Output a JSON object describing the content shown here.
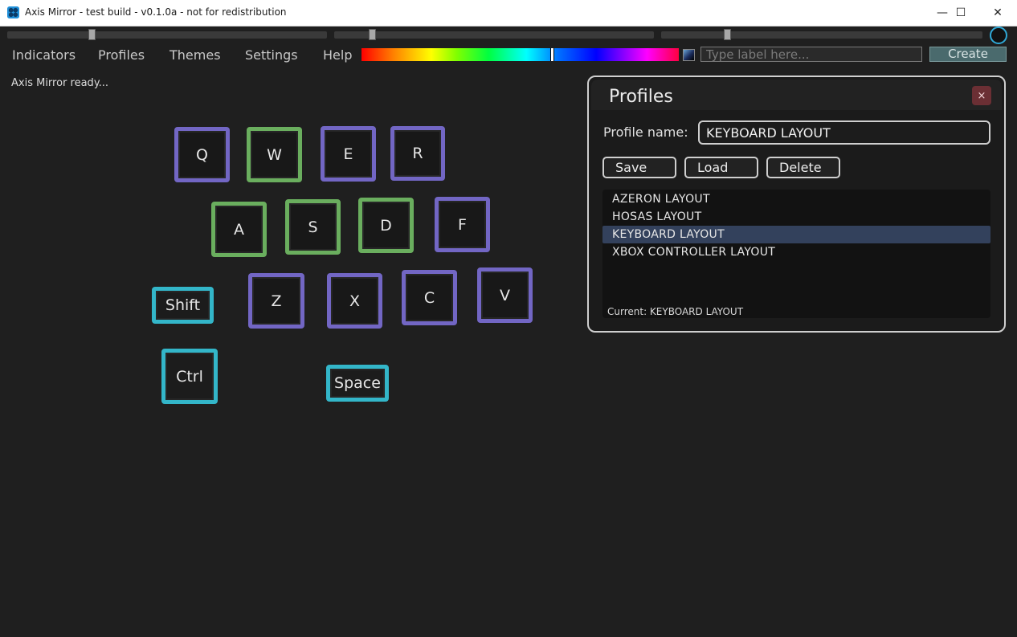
{
  "window": {
    "title": "Axis Mirror - test build - v0.1.0a - not for redistribution",
    "minimize_glyph": "—",
    "maximize_glyph": "☐",
    "close_glyph": "✕"
  },
  "toolbar": {
    "sliders": [
      {
        "name": "slider-1",
        "value_pct": 26
      },
      {
        "name": "slider-2",
        "value_pct": 11
      },
      {
        "name": "slider-3",
        "value_pct": 20
      }
    ],
    "dial_color": "#2fa8d6"
  },
  "menu": {
    "items": [
      "Indicators",
      "Profiles",
      "Themes",
      "Settings",
      "Help"
    ]
  },
  "color_picker": {
    "selected_hue_pct": 60
  },
  "label_input": {
    "value": "",
    "placeholder": "Type label here..."
  },
  "create_label": "Create",
  "status_text": "Axis Mirror ready...",
  "colors": {
    "purple": "#7266c4",
    "green": "#6aae5e",
    "cyan": "#33b6c9",
    "panel_border": "#cfcfcf",
    "selected_row": "#33415c",
    "close_button": "#6b2f34"
  },
  "keys": [
    {
      "label": "Q",
      "color": "purple"
    },
    {
      "label": "W",
      "color": "green"
    },
    {
      "label": "E",
      "color": "purple"
    },
    {
      "label": "R",
      "color": "purple"
    },
    {
      "label": "A",
      "color": "green"
    },
    {
      "label": "S",
      "color": "green"
    },
    {
      "label": "D",
      "color": "green"
    },
    {
      "label": "F",
      "color": "purple"
    },
    {
      "label": "Shift",
      "color": "cyan"
    },
    {
      "label": "Z",
      "color": "purple"
    },
    {
      "label": "X",
      "color": "purple"
    },
    {
      "label": "C",
      "color": "purple"
    },
    {
      "label": "V",
      "color": "purple"
    },
    {
      "label": "Ctrl",
      "color": "cyan"
    },
    {
      "label": "Space",
      "color": "cyan"
    }
  ],
  "profiles_panel": {
    "title": "Profiles",
    "close_glyph": "×",
    "name_label": "Profile name:",
    "name_value": "KEYBOARD LAYOUT",
    "buttons": {
      "save": "Save",
      "load": "Load",
      "delete": "Delete"
    },
    "profiles": [
      "AZERON LAYOUT",
      "HOSAS LAYOUT",
      "KEYBOARD LAYOUT",
      "XBOX CONTROLLER LAYOUT"
    ],
    "selected_index": 2,
    "current_text": "Current: KEYBOARD LAYOUT"
  }
}
